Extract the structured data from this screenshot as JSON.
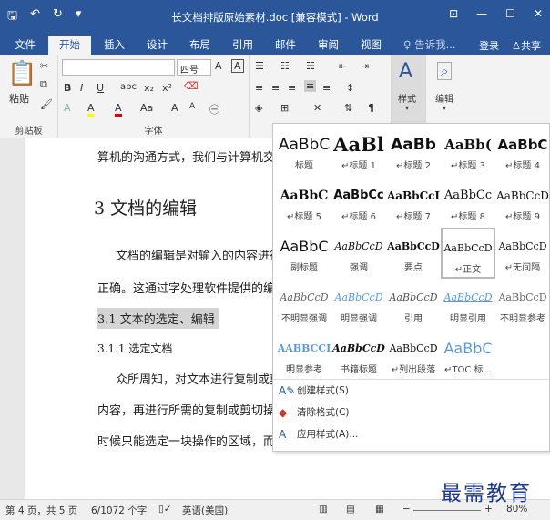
{
  "titlebar": {
    "qat_icons": [
      "save-icon",
      "undo-icon",
      "redo-icon",
      "customize-icon"
    ],
    "title": "长文档排版原始素材.doc [兼容模式] - Word",
    "window_icons": [
      "ribbon-display-icon",
      "minimize-icon",
      "maximize-icon",
      "close-icon"
    ]
  },
  "tabs": {
    "items": [
      "文件",
      "开始",
      "插入",
      "设计",
      "布局",
      "引用",
      "邮件",
      "审阅",
      "视图"
    ],
    "active": "开始",
    "tell_me": "告诉我...",
    "login": "登录",
    "share": "共享"
  },
  "ribbon": {
    "clipboard": {
      "label": "剪贴板",
      "paste": "粘贴"
    },
    "font": {
      "label": "字体",
      "font_name": "",
      "font_size": "四号",
      "buttons": [
        "B",
        "I",
        "U",
        "abc",
        "x₂",
        "x²"
      ],
      "bottom": [
        "A",
        "A",
        "A",
        "Aa",
        "A",
        "A"
      ]
    },
    "paragraph": {
      "label": ""
    },
    "styles": {
      "label": "样式"
    },
    "editing": {
      "label": "编辑"
    }
  },
  "document": {
    "lines": [
      {
        "text": "算机的沟通方式，我们与计算机交"
      },
      {
        "text": "3 文档的编辑"
      },
      {
        "text": "文档的编辑是对输入的内容进行"
      },
      {
        "text": "正确。这通过字处理软件提供的编"
      },
      {
        "text": "3.1 文本的选定、编辑"
      },
      {
        "text": "3.1.1 选定文档"
      },
      {
        "text": "众所周知，对文本进行复制或剪"
      },
      {
        "text": "内容，再进行所需的复制或剪切操"
      },
      {
        "text": "时候只能选定一块操作的区域，而有"
      }
    ]
  },
  "styles_gallery": {
    "rows": [
      [
        {
          "sample": "AaBbC",
          "name": "标题"
        },
        {
          "sample": "AaBl",
          "name": "↵标题 1"
        },
        {
          "sample": "AaBb",
          "name": "↵标题 2"
        },
        {
          "sample": "AaBb(",
          "name": "↵标题 3"
        },
        {
          "sample": "AaBbC",
          "name": "↵标题 4"
        }
      ],
      [
        {
          "sample": "AaBbC",
          "name": "↵标题 5"
        },
        {
          "sample": "AaBbCc",
          "name": "↵标题 6"
        },
        {
          "sample": "AaBbCcI",
          "name": "↵标题 7"
        },
        {
          "sample": "AaBbCc",
          "name": "↵标题 8"
        },
        {
          "sample": "AaBbCcD",
          "name": "↵标题 9"
        }
      ],
      [
        {
          "sample": "AaBbC",
          "name": "副标题"
        },
        {
          "sample": "AaBbCcD",
          "name": "强调"
        },
        {
          "sample": "AaBbCcD",
          "name": "要点"
        },
        {
          "sample": "AaBbCcD",
          "name": "↵正文"
        },
        {
          "sample": "AaBbCcD",
          "name": "↵无间隔"
        }
      ],
      [
        {
          "sample": "AaBbCcD",
          "name": "不明显强调"
        },
        {
          "sample": "AaBbCcD",
          "name": "明显强调"
        },
        {
          "sample": "AaBbCcD",
          "name": "引用"
        },
        {
          "sample": "AaBbCcD",
          "name": "明显引用"
        },
        {
          "sample": "AaBbCcD",
          "name": "不明显参考"
        }
      ],
      [
        {
          "sample": "AABBCCI",
          "name": "明显参考"
        },
        {
          "sample": "AaBbCcD",
          "name": "书籍标题"
        },
        {
          "sample": "AaBbCcD",
          "name": "↵列出段落"
        },
        {
          "sample": "AaBbC",
          "name": "↵TOC 标..."
        }
      ]
    ],
    "selected": "↵正文",
    "menu": [
      "创建样式(S)",
      "清除格式(C)",
      "应用样式(A)..."
    ]
  },
  "statusbar": {
    "page": "第 4 页，共 5 页",
    "words": "6/1072 个字",
    "language": "英语(美国)",
    "zoom": "80%"
  },
  "watermark": "最需教育",
  "colors": {
    "accent": "#2b579a"
  }
}
